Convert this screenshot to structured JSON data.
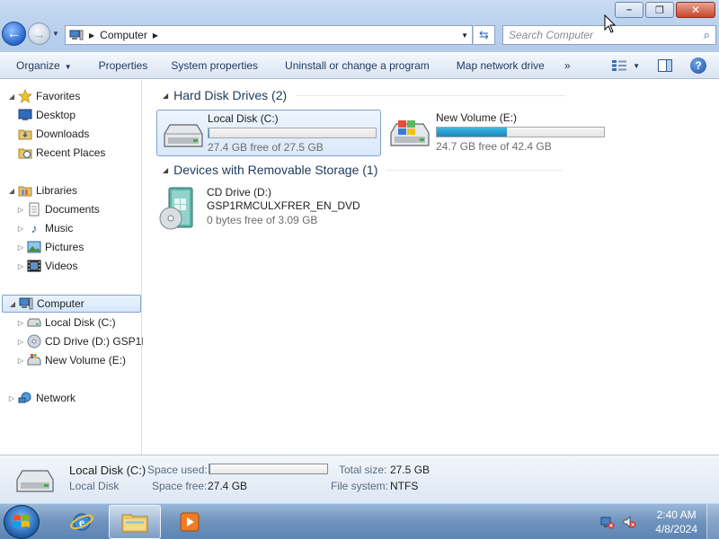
{
  "window": {
    "address_crumb": "Computer",
    "search_placeholder": "Search Computer"
  },
  "commandbar": {
    "organize": "Organize",
    "properties": "Properties",
    "system_properties": "System properties",
    "uninstall": "Uninstall or change a program",
    "map_drive": "Map network drive",
    "more": "»"
  },
  "sidebar": {
    "favorites": "Favorites",
    "desktop": "Desktop",
    "downloads": "Downloads",
    "recent_places": "Recent Places",
    "libraries": "Libraries",
    "documents": "Documents",
    "music": "Music",
    "pictures": "Pictures",
    "videos": "Videos",
    "computer": "Computer",
    "local_disk": "Local Disk (C:)",
    "cd_drive": "CD Drive (D:) GSP1R",
    "new_volume": "New Volume (E:)",
    "network": "Network"
  },
  "content": {
    "hdd_group": "Hard Disk Drives (2)",
    "removable_group": "Devices with Removable Storage (1)",
    "drives": [
      {
        "name": "Local Disk (C:)",
        "free": "27.4 GB free of 27.5 GB",
        "used_fraction": 0.004
      },
      {
        "name": "New Volume (E:)",
        "free": "24.7 GB free of 42.4 GB",
        "used_fraction": 0.42
      }
    ],
    "cd": {
      "name": "CD Drive (D:)",
      "label": "GSP1RMCULXFRER_EN_DVD",
      "free": "0 bytes free of 3.09 GB"
    }
  },
  "details": {
    "name": "Local Disk (C:)",
    "type": "Local Disk",
    "space_used_label": "Space used:",
    "space_free_label": "Space free:",
    "space_free": "27.4 GB",
    "total_size_label": "Total size:",
    "total_size": "27.5 GB",
    "file_system_label": "File system:",
    "file_system": "NTFS",
    "used_fraction": 0.004
  },
  "taskbar": {
    "time": "2:40 AM",
    "date": "4/8/2024"
  }
}
